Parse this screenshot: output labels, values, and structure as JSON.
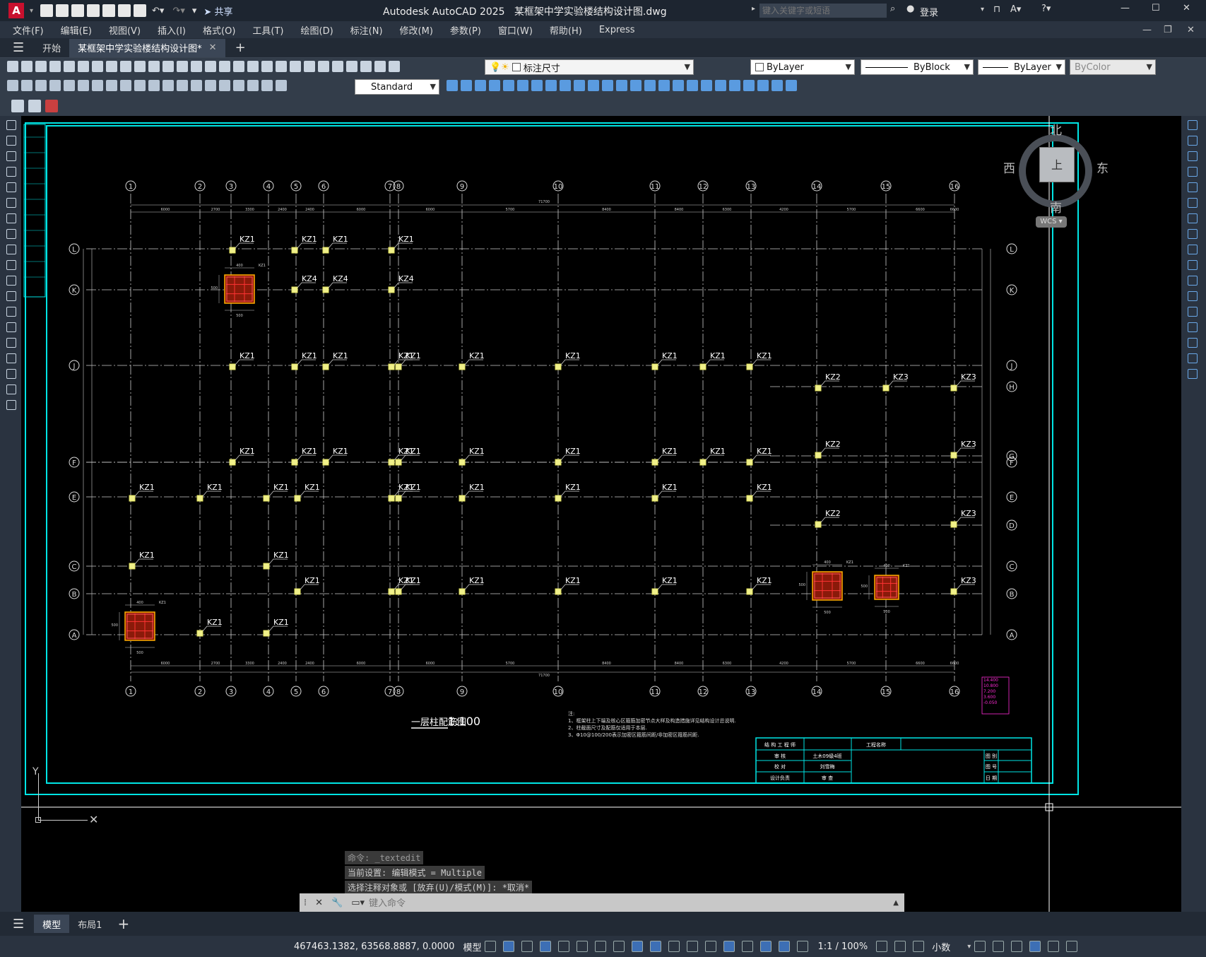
{
  "app": {
    "title": "Autodesk AutoCAD 2025",
    "filename": "某框架中学实验楼结构设计图.dwg",
    "share": "共享",
    "search_placeholder": "键入关键字或短语",
    "login": "登录"
  },
  "menu": [
    "文件(F)",
    "编辑(E)",
    "视图(V)",
    "插入(I)",
    "格式(O)",
    "工具(T)",
    "绘图(D)",
    "标注(N)",
    "修改(M)",
    "参数(P)",
    "窗口(W)",
    "帮助(H)",
    "Express"
  ],
  "tabs": {
    "start": "开始",
    "doc": "某框架中学实验楼结构设计图*"
  },
  "toolbar": {
    "layer": "标注尺寸",
    "color": "ByLayer",
    "linetype": "ByBlock",
    "lineweight": "ByLayer",
    "plotstyle": "ByColor",
    "textstyle": "Standard"
  },
  "viewcube": {
    "north": "北",
    "south": "南",
    "east": "东",
    "west": "西",
    "top": "上",
    "wcs": "WCS"
  },
  "drawing": {
    "axes_x": [
      "1",
      "2",
      "3",
      "4",
      "5",
      "6",
      "7",
      "8",
      "9",
      "10",
      "11",
      "12",
      "13",
      "14",
      "15",
      "16"
    ],
    "axes_y": [
      "L",
      "K",
      "J",
      "H",
      "G",
      "F",
      "E",
      "D",
      "C",
      "B",
      "A"
    ],
    "overall_dim": "71700",
    "dims_top": [
      "6000",
      "2700",
      "3300",
      "2400",
      "2400",
      "6000",
      "6000",
      "5700",
      "8400",
      "8400",
      "6300",
      "4200",
      "5700",
      "6600",
      "6600"
    ],
    "column_labels": [
      "KZ1",
      "KZ2",
      "KZ3",
      "KZ4"
    ],
    "detail_dims": [
      "400",
      "500",
      "300"
    ],
    "plan_title": "一层柱配筋图",
    "plan_scale": "1:100",
    "notes_title": "注:",
    "notes": [
      "1、框架柱上下端及核心区箍筋加密节点大样及构造措施详见结构设计总说明.",
      "2、柱截面尺寸及配筋仅适用于本层.",
      "3、Φ10@100/200表示加密区箍筋间距/非加密区箍筋间距."
    ],
    "legend": [
      "14.400",
      "10.800",
      "7.200",
      "3.600",
      "-0.050"
    ],
    "titleblock": {
      "firm": "结 构 工 程 师",
      "project": "工程名称",
      "r1a": "审 核",
      "r1b": "土木09级4班",
      "r2a": "校 对",
      "r2b": "刘雪梅",
      "r3a": "设计负责",
      "r3b": "审 查",
      "c1": "图 别",
      "c2": "图 号",
      "c3": "日 期"
    }
  },
  "command": {
    "line1": "命令: _textedit",
    "line2": "当前设置: 编辑模式 = Multiple",
    "line3": "选择注释对象或 [放弃(U)/模式(M)]: *取消*",
    "input_placeholder": "键入命令"
  },
  "layout_tabs": {
    "model": "模型",
    "layout1": "布局1"
  },
  "status": {
    "coords": "467463.1382, 63568.8887, 0.0000",
    "model": "模型",
    "scale": "1:1 / 100%",
    "units": "小数"
  }
}
